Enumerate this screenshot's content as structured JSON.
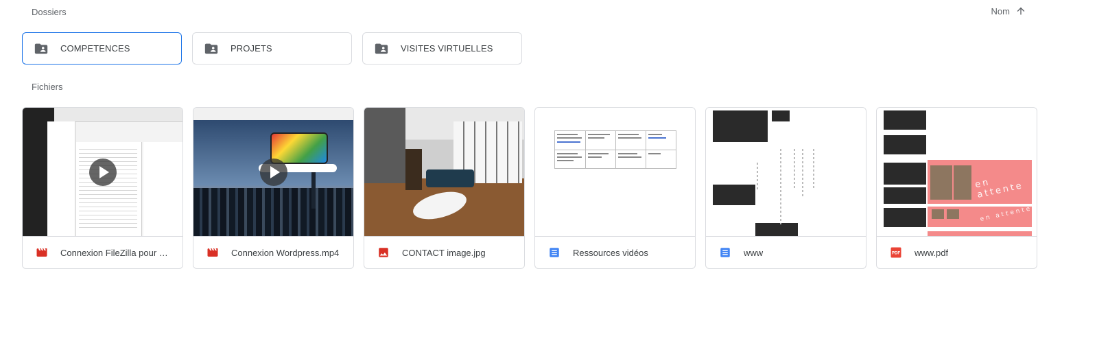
{
  "sections": {
    "folders_title": "Dossiers",
    "files_title": "Fichiers"
  },
  "sort": {
    "label": "Nom",
    "direction_icon": "arrow-up-icon"
  },
  "folders": [
    {
      "label": "COMPETENCES",
      "icon": "shared-folder-icon",
      "selected": true
    },
    {
      "label": "PROJETS",
      "icon": "shared-folder-icon",
      "selected": false
    },
    {
      "label": "VISITES VIRTUELLES",
      "icon": "shared-folder-icon",
      "selected": false
    }
  ],
  "files": [
    {
      "name": "Connexion FileZilla pour m...",
      "type_icon": "video-file-icon",
      "video": true
    },
    {
      "name": "Connexion Wordpress.mp4",
      "type_icon": "video-file-icon",
      "video": true
    },
    {
      "name": "CONTACT image.jpg",
      "type_icon": "image-file-icon",
      "video": false
    },
    {
      "name": "Ressources vidéos",
      "type_icon": "google-docs-icon",
      "video": false
    },
    {
      "name": "www",
      "type_icon": "google-docs-icon",
      "video": false
    },
    {
      "name": "www.pdf",
      "type_icon": "pdf-file-icon",
      "video": false
    }
  ],
  "colors": {
    "selected_border": "#1a73e8",
    "video_icon": "#d93025",
    "docs_icon": "#4285f4",
    "pdf_icon": "#ea4335",
    "folder_icon": "#5f6368"
  }
}
